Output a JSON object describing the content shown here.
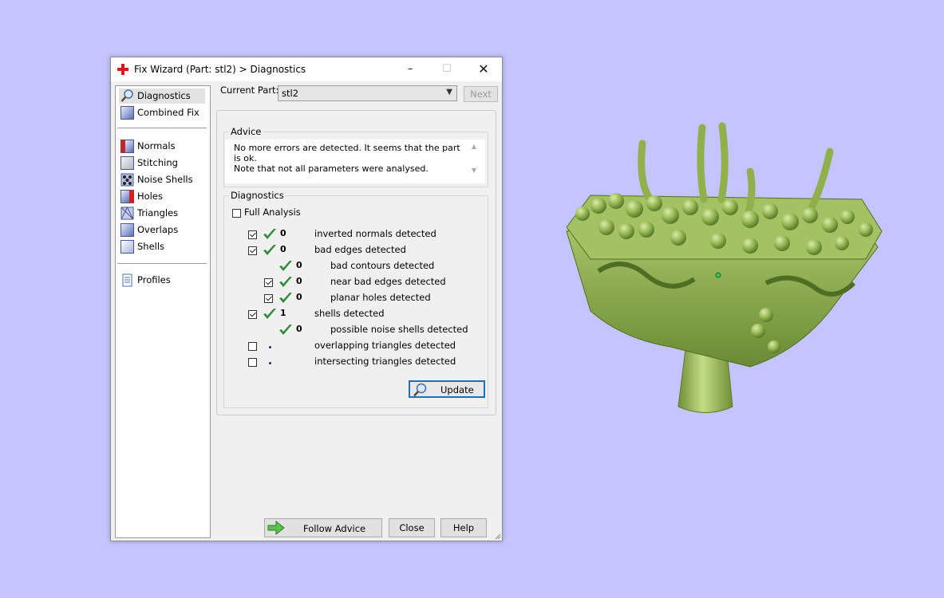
{
  "window": {
    "title": "Fix Wizard (Part: stl2) > Diagnostics",
    "controls": {
      "minimize": "–",
      "maximize": "☐",
      "close": "✕"
    }
  },
  "sidebar": {
    "items": [
      {
        "label": "Diagnostics",
        "icon": "magnifier-icon",
        "selected": true
      },
      {
        "label": "Combined Fix",
        "icon": "cube-icon"
      },
      {
        "label": "Normals",
        "icon": "normals-cube-icon"
      },
      {
        "label": "Stitching",
        "icon": "stitching-cube-icon"
      },
      {
        "label": "Noise Shells",
        "icon": "noise-shells-icon"
      },
      {
        "label": "Holes",
        "icon": "holes-cube-icon"
      },
      {
        "label": "Triangles",
        "icon": "triangles-cube-icon"
      },
      {
        "label": "Overlaps",
        "icon": "overlaps-cube-icon"
      },
      {
        "label": "Shells",
        "icon": "shells-cube-icon"
      },
      {
        "label": "Profiles",
        "icon": "document-icon"
      }
    ]
  },
  "current_part": {
    "label": "Current Part:",
    "value": "stl2",
    "next_label": "Next"
  },
  "advice": {
    "title": "Advice",
    "line1": "No more errors are detected. It seems that the part is ok.",
    "line2": "Note that not all parameters were analysed."
  },
  "diagnostics": {
    "title": "Diagnostics",
    "full_analysis_label": "Full Analysis",
    "full_analysis_checked": false,
    "rows": [
      {
        "checked": true,
        "status": "ok",
        "value": "0",
        "label": "inverted normals detected",
        "level": 0
      },
      {
        "checked": true,
        "status": "ok",
        "value": "0",
        "label": "bad edges detected",
        "level": 0
      },
      {
        "checked": null,
        "status": "ok",
        "value": "0",
        "label": "bad contours detected",
        "level": 1
      },
      {
        "checked": true,
        "status": "ok",
        "value": "0",
        "label": "near bad edges detected",
        "level": 1
      },
      {
        "checked": true,
        "status": "ok",
        "value": "0",
        "label": "planar holes detected",
        "level": 1
      },
      {
        "checked": true,
        "status": "ok",
        "value": "1",
        "label": "shells detected",
        "level": 0
      },
      {
        "checked": null,
        "status": "ok",
        "value": "0",
        "label": "possible noise shells detected",
        "level": 1
      },
      {
        "checked": false,
        "status": "none",
        "value": "",
        "label": "overlapping triangles detected",
        "level": 0
      },
      {
        "checked": false,
        "status": "none",
        "value": "",
        "label": "intersecting triangles detected",
        "level": 0
      }
    ],
    "update_label": "Update"
  },
  "footer": {
    "follow_label": "Follow Advice",
    "close_label": "Close",
    "help_label": "Help"
  },
  "colors": {
    "background": "#c6c4ff",
    "model_green": "#9cbd5a",
    "check_green": "#2e8b3a",
    "focus_blue": "#1d6fbf"
  }
}
